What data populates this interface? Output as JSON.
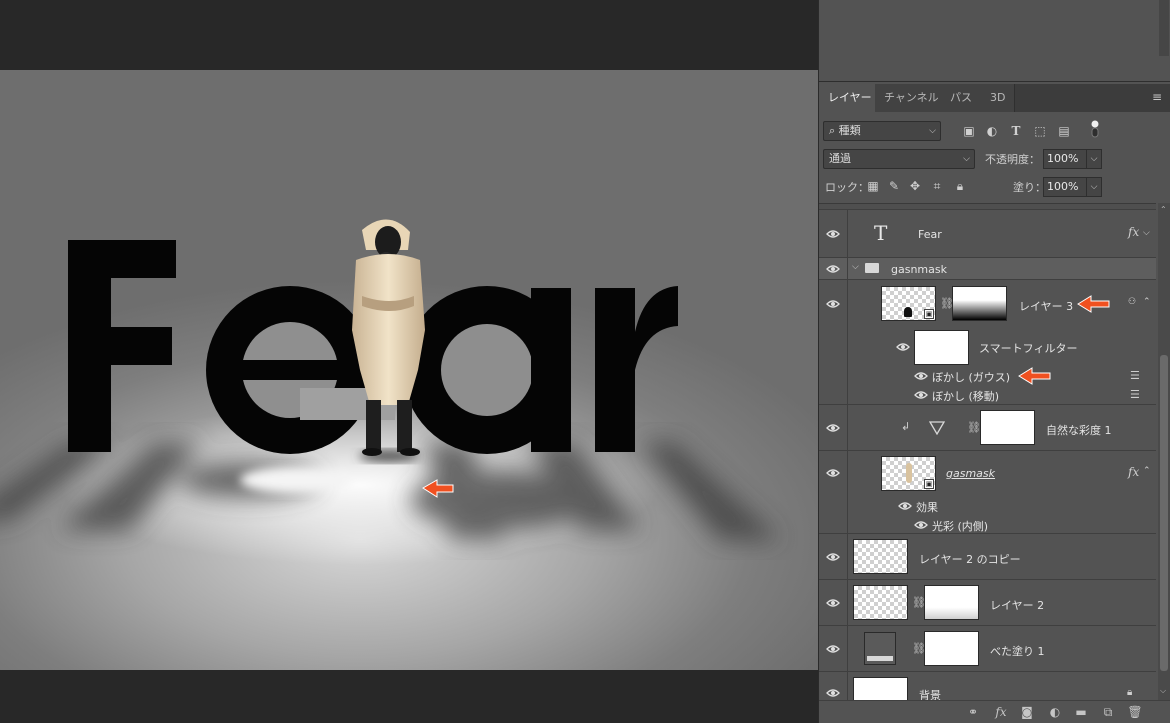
{
  "canvas": {
    "text": "Fear"
  },
  "panel": {
    "tabs": [
      {
        "label": "レイヤー",
        "active": true
      },
      {
        "label": "チャンネル",
        "active": false
      },
      {
        "label": "パス",
        "active": false
      },
      {
        "label": "3D",
        "active": false
      }
    ],
    "filter": {
      "kind_label": "種類"
    },
    "blend_mode": "通過",
    "opacity_label": "不透明度：",
    "opacity_value": "100%",
    "lock_label": "ロック：",
    "fill_label": "塗り：",
    "fill_value": "100%"
  },
  "layers": {
    "fear": {
      "name": "Fear"
    },
    "group": {
      "name": "gasnmask"
    },
    "layer3": {
      "name": "レイヤー 3"
    },
    "smart_filter": {
      "name": "スマートフィルター"
    },
    "filters": [
      "ぼかし (ガウス)",
      "ぼかし (移動)"
    ],
    "vibrance": {
      "name": "自然な彩度 1"
    },
    "gasmask": {
      "name": "gasmask",
      "effects_label": "効果",
      "effect": "光彩 (内側)"
    },
    "layer2_copy": {
      "name": "レイヤー 2 のコピー"
    },
    "layer2": {
      "name": "レイヤー 2"
    },
    "fill1": {
      "name": "べた塗り 1"
    },
    "background": {
      "name": "背景"
    }
  },
  "colors": {
    "panel_bg": "#535353",
    "tab_bar": "#3c3c3c",
    "workspace": "#282828",
    "annotation_arrow": "#f05020"
  }
}
